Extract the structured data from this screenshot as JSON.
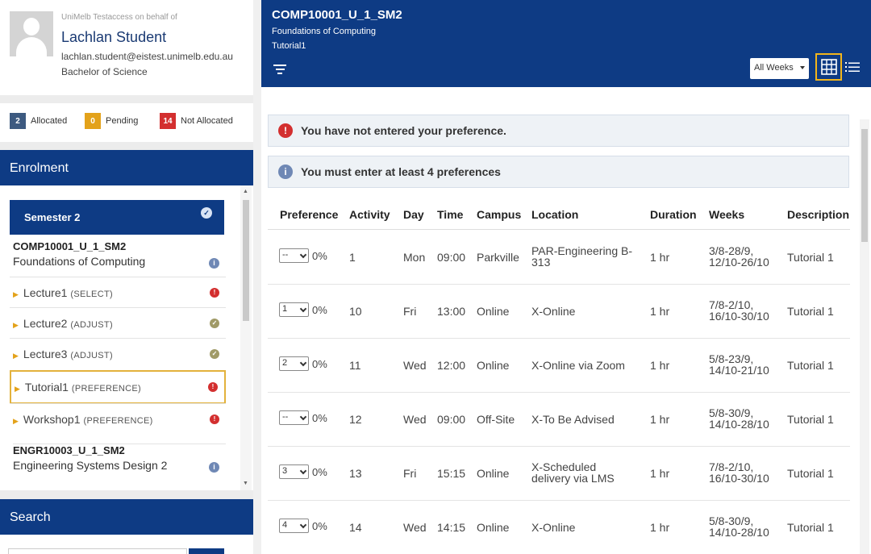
{
  "profile": {
    "on_behalf": "UniMelb Testaccess on behalf of",
    "name": "Lachlan Student",
    "email": "lachlan.student@eistest.unimelb.edu.au",
    "degree": "Bachelor of Science"
  },
  "status": {
    "allocated": {
      "count": "2",
      "label": "Allocated",
      "color": "#3d5a80"
    },
    "pending": {
      "count": "0",
      "label": "Pending",
      "color": "#e3a21a"
    },
    "not_allocated": {
      "count": "14",
      "label": "Not Allocated",
      "color": "#d32f2f"
    }
  },
  "enrolment": {
    "title": "Enrolment",
    "semester": "Semester 2",
    "subjects": [
      {
        "code": "COMP10001_U_1_SM2",
        "name": "Foundations of Computing"
      },
      {
        "code": "ENGR10003_U_1_SM2",
        "name": "Engineering Systems Design 2"
      }
    ],
    "activities": [
      {
        "name": "Lecture1",
        "tag": "(SELECT)",
        "status": "error"
      },
      {
        "name": "Lecture2",
        "tag": "(ADJUST)",
        "status": "ok"
      },
      {
        "name": "Lecture3",
        "tag": "(ADJUST)",
        "status": "ok"
      },
      {
        "name": "Tutorial1",
        "tag": "(PREFERENCE)",
        "status": "error"
      },
      {
        "name": "Workshop1",
        "tag": "(PREFERENCE)",
        "status": "error"
      }
    ]
  },
  "search": {
    "title": "Search"
  },
  "header": {
    "code": "COMP10001_U_1_SM2",
    "subject": "Foundations of Computing",
    "activity": "Tutorial1",
    "weeks_filter": "All Weeks"
  },
  "alerts": {
    "error": "You have not entered your preference.",
    "info": "You must enter at least 4 preferences"
  },
  "table": {
    "headers": {
      "preference": "Preference",
      "activity": "Activity",
      "day": "Day",
      "time": "Time",
      "campus": "Campus",
      "location": "Location",
      "duration": "Duration",
      "weeks": "Weeks",
      "description": "Description"
    },
    "rows": [
      {
        "pref": "--",
        "pct": "0%",
        "activity": "1",
        "day": "Mon",
        "time": "09:00",
        "campus": "Parkville",
        "location1": "PAR-Engineering B-",
        "location2": "313",
        "duration": "1 hr",
        "weeks1": "3/8-28/9,",
        "weeks2": "12/10-26/10",
        "description": "Tutorial 1"
      },
      {
        "pref": "1",
        "pct": "0%",
        "activity": "10",
        "day": "Fri",
        "time": "13:00",
        "campus": "Online",
        "location1": "X-Online",
        "location2": "",
        "duration": "1 hr",
        "weeks1": "7/8-2/10,",
        "weeks2": "16/10-30/10",
        "description": "Tutorial 1"
      },
      {
        "pref": "2",
        "pct": "0%",
        "activity": "11",
        "day": "Wed",
        "time": "12:00",
        "campus": "Online",
        "location1": "X-Online via Zoom",
        "location2": "",
        "duration": "1 hr",
        "weeks1": "5/8-23/9,",
        "weeks2": "14/10-21/10",
        "description": "Tutorial 1"
      },
      {
        "pref": "--",
        "pct": "0%",
        "activity": "12",
        "day": "Wed",
        "time": "09:00",
        "campus": "Off-Site",
        "location1": "X-To Be Advised",
        "location2": "",
        "duration": "1 hr",
        "weeks1": "5/8-30/9,",
        "weeks2": "14/10-28/10",
        "description": "Tutorial 1"
      },
      {
        "pref": "3",
        "pct": "0%",
        "activity": "13",
        "day": "Fri",
        "time": "15:15",
        "campus": "Online",
        "location1": "X-Scheduled",
        "location2": "delivery via LMS",
        "duration": "1 hr",
        "weeks1": "7/8-2/10,",
        "weeks2": "16/10-30/10",
        "description": "Tutorial 1"
      },
      {
        "pref": "4",
        "pct": "0%",
        "activity": "14",
        "day": "Wed",
        "time": "14:15",
        "campus": "Online",
        "location1": "X-Online",
        "location2": "",
        "duration": "1 hr",
        "weeks1": "5/8-30/9,",
        "weeks2": "14/10-28/10",
        "description": "Tutorial 1"
      }
    ]
  }
}
